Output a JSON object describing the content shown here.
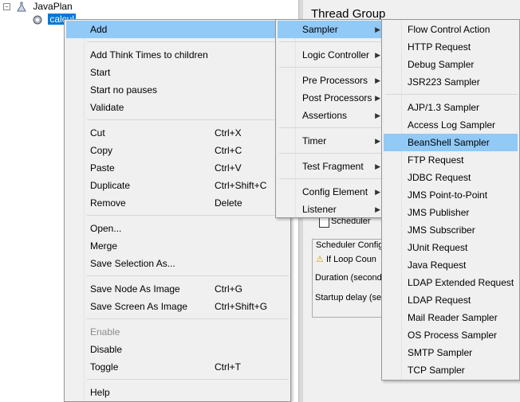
{
  "tree": {
    "root_label": "JavaPlan",
    "child_label": "calcul",
    "collapse_glyph": "−"
  },
  "right_panel": {
    "title": "Thread Group",
    "scheduler_checkbox_label": "Scheduler",
    "scheduler_config_label": "Scheduler Config",
    "loop_warning": "If Loop Coun",
    "duration_label": "Duration (second",
    "startup_label": "Startup delay (se"
  },
  "context_menu": {
    "items": [
      {
        "label": "Add",
        "shortcut": "",
        "submenu": true,
        "highlighted": true
      },
      {
        "label": "Add Think Times to children",
        "shortcut": ""
      },
      {
        "label": "Start",
        "shortcut": ""
      },
      {
        "label": "Start no pauses",
        "shortcut": ""
      },
      {
        "label": "Validate",
        "shortcut": ""
      },
      {
        "label": "Cut",
        "shortcut": "Ctrl+X"
      },
      {
        "label": "Copy",
        "shortcut": "Ctrl+C"
      },
      {
        "label": "Paste",
        "shortcut": "Ctrl+V"
      },
      {
        "label": "Duplicate",
        "shortcut": "Ctrl+Shift+C"
      },
      {
        "label": "Remove",
        "shortcut": "Delete"
      },
      {
        "label": "Open...",
        "shortcut": ""
      },
      {
        "label": "Merge",
        "shortcut": ""
      },
      {
        "label": "Save Selection As...",
        "shortcut": ""
      },
      {
        "label": "Save Node As Image",
        "shortcut": "Ctrl+G"
      },
      {
        "label": "Save Screen As Image",
        "shortcut": "Ctrl+Shift+G"
      },
      {
        "label": "Enable",
        "shortcut": "",
        "disabled": true
      },
      {
        "label": "Disable",
        "shortcut": ""
      },
      {
        "label": "Toggle",
        "shortcut": "Ctrl+T"
      },
      {
        "label": "Help",
        "shortcut": ""
      }
    ]
  },
  "add_submenu": {
    "items": [
      {
        "label": "Sampler",
        "highlighted": true
      },
      {
        "label": "Logic Controller"
      },
      {
        "label": "Pre Processors"
      },
      {
        "label": "Post Processors"
      },
      {
        "label": "Assertions"
      },
      {
        "label": "Timer"
      },
      {
        "label": "Test Fragment"
      },
      {
        "label": "Config Element"
      },
      {
        "label": "Listener"
      }
    ]
  },
  "sampler_submenu": {
    "items": [
      {
        "label": "Flow Control Action"
      },
      {
        "label": "HTTP Request"
      },
      {
        "label": "Debug Sampler"
      },
      {
        "label": "JSR223 Sampler"
      },
      {
        "label": "AJP/1.3 Sampler"
      },
      {
        "label": "Access Log Sampler"
      },
      {
        "label": "BeanShell Sampler",
        "highlighted": true
      },
      {
        "label": "FTP Request"
      },
      {
        "label": "JDBC Request"
      },
      {
        "label": "JMS Point-to-Point"
      },
      {
        "label": "JMS Publisher"
      },
      {
        "label": "JMS Subscriber"
      },
      {
        "label": "JUnit Request"
      },
      {
        "label": "Java Request"
      },
      {
        "label": "LDAP Extended Request"
      },
      {
        "label": "LDAP Request"
      },
      {
        "label": "Mail Reader Sampler"
      },
      {
        "label": "OS Process Sampler"
      },
      {
        "label": "SMTP Sampler"
      },
      {
        "label": "TCP Sampler"
      }
    ]
  },
  "colors": {
    "highlight": "#91c9f7",
    "menu_bg": "#f0f0f0",
    "tree_selection": "#0078d7"
  }
}
